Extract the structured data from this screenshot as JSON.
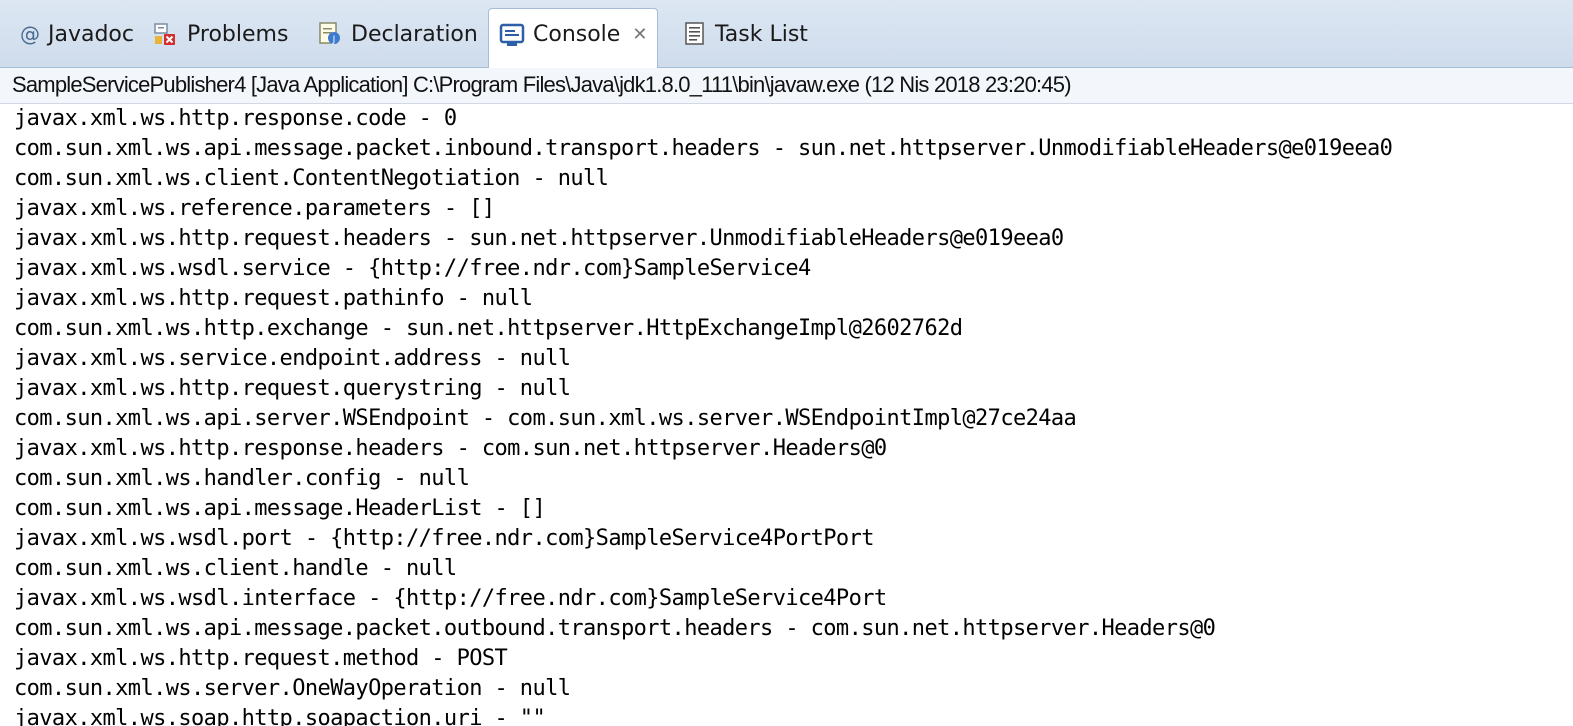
{
  "tabs": [
    {
      "label": "Javadoc",
      "icon": "at-sign-icon"
    },
    {
      "label": "Problems",
      "icon": "problems-icon"
    },
    {
      "label": "Declaration",
      "icon": "declaration-icon"
    },
    {
      "label": "Console",
      "icon": "console-icon",
      "active": true,
      "close": "✕"
    },
    {
      "label": "Task List",
      "icon": "task-list-icon"
    }
  ],
  "launch_info": "SampleServicePublisher4 [Java Application] C:\\Program Files\\Java\\jdk1.8.0_111\\bin\\javaw.exe (12 Nis 2018 23:20:45)",
  "console_lines": [
    "javax.xml.ws.http.response.code - 0",
    "com.sun.xml.ws.api.message.packet.inbound.transport.headers - sun.net.httpserver.UnmodifiableHeaders@e019eea0",
    "com.sun.xml.ws.client.ContentNegotiation - null",
    "javax.xml.ws.reference.parameters - []",
    "javax.xml.ws.http.request.headers - sun.net.httpserver.UnmodifiableHeaders@e019eea0",
    "javax.xml.ws.wsdl.service - {http://free.ndr.com}SampleService4",
    "javax.xml.ws.http.request.pathinfo - null",
    "com.sun.xml.ws.http.exchange - sun.net.httpserver.HttpExchangeImpl@2602762d",
    "javax.xml.ws.service.endpoint.address - null",
    "javax.xml.ws.http.request.querystring - null",
    "com.sun.xml.ws.api.server.WSEndpoint - com.sun.xml.ws.server.WSEndpointImpl@27ce24aa",
    "javax.xml.ws.http.response.headers - com.sun.net.httpserver.Headers@0",
    "com.sun.xml.ws.handler.config - null",
    "com.sun.xml.ws.api.message.HeaderList - []",
    "javax.xml.ws.wsdl.port - {http://free.ndr.com}SampleService4PortPort",
    "com.sun.xml.ws.client.handle - null",
    "javax.xml.ws.wsdl.interface - {http://free.ndr.com}SampleService4Port",
    "com.sun.xml.ws.api.message.packet.outbound.transport.headers - com.sun.net.httpserver.Headers@0",
    "javax.xml.ws.http.request.method - POST",
    "com.sun.xml.ws.server.OneWayOperation - null",
    "javax.xml.ws.soap.http.soapaction.uri - \"\""
  ]
}
